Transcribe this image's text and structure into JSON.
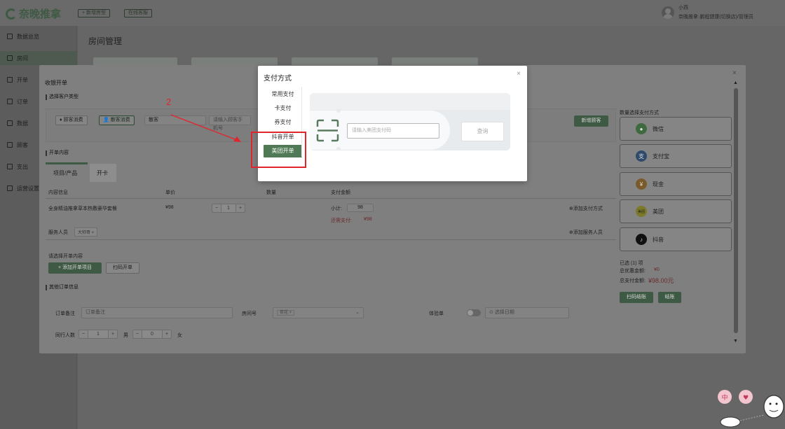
{
  "header": {
    "brand": "奈晚推拿",
    "btn_new_room": "+ 新增房型",
    "btn_online": "在线客服",
    "user_name": "小燕",
    "user_org": "奈晚推拿·鹏程健康(切换店)/管理员"
  },
  "sidebar": {
    "items": [
      {
        "label": "数据总览"
      },
      {
        "label": "房间"
      },
      {
        "label": "开单"
      },
      {
        "label": "订单"
      },
      {
        "label": "数据"
      },
      {
        "label": "顾客"
      },
      {
        "label": "支出"
      },
      {
        "label": "运营设置"
      }
    ]
  },
  "page": {
    "title": "房间管理"
  },
  "order_modal": {
    "title": "收银开单",
    "customer_section": "选择客户类型",
    "member_chip": "顾客消费",
    "scatter_chip": "散客消费",
    "scatter_value": "散客",
    "phone_placeholder": "请输入顾客手机号",
    "new_customer": "新增顾客",
    "content_section": "开单内容",
    "tab_products": "项目/产品",
    "tab_card": "开卡",
    "col_content": "内容信息",
    "col_price": "单价",
    "col_qty": "数量",
    "col_amount": "支付金额",
    "item_name": "全身精油推拿草本热敷豪华套餐",
    "item_price": "¥98",
    "item_qty": "1",
    "subtotal_label": "小计:",
    "subtotal_value": "98",
    "due_label": "还需支付:",
    "due_value": "¥98",
    "add_payment": "⊕添加支付方式",
    "staff_label": "服务人员",
    "staff_tag": "大帅哥",
    "add_staff": "⊕添加服务人员",
    "select_content": "请选择开单内容",
    "add_item_btn": "+ 添加开单项目",
    "scan_btn": "扫码开单",
    "other_section": "其他订单信息",
    "remark_label": "订单备注",
    "remark_placeholder": "订单备注",
    "room_label": "房间号",
    "room_tag": "荷花",
    "trial_label": "体验单",
    "date_placeholder": "选择日期",
    "people_label": "同行人数",
    "male_count": "1",
    "male_label": "男",
    "female_count": "0",
    "female_label": "女",
    "pay_methods_title": "数量选择支付方式",
    "pay_methods": [
      {
        "label": "微信",
        "icon": "wechat-icon",
        "color": "#3f6a3f"
      },
      {
        "label": "支付宝",
        "icon": "alipay-icon",
        "color": "#2f4a6a"
      },
      {
        "label": "现金",
        "icon": "cash-icon",
        "color": "#7a5a2a"
      },
      {
        "label": "美团",
        "icon": "meituan-icon",
        "color": "#7a7a2a"
      },
      {
        "label": "抖音",
        "icon": "douyin-icon",
        "color": "#111111"
      }
    ],
    "selected_count": "已选 (1) 项",
    "discount_label": "总优惠金额:",
    "discount_value": "¥0",
    "total_label": "总支付金额:",
    "total_value": "¥98.00元",
    "scan_checkout": "扫码结账",
    "checkout": "结账"
  },
  "payment_modal": {
    "title": "支付方式",
    "tabs": [
      "常用支付",
      "卡支付",
      "券支付",
      "抖音开单",
      "美团开单"
    ],
    "active_tab": "美团开单",
    "input_placeholder": "请输入美团支付码",
    "query_btn": "查询"
  },
  "annotation": {
    "step_number": "2"
  }
}
